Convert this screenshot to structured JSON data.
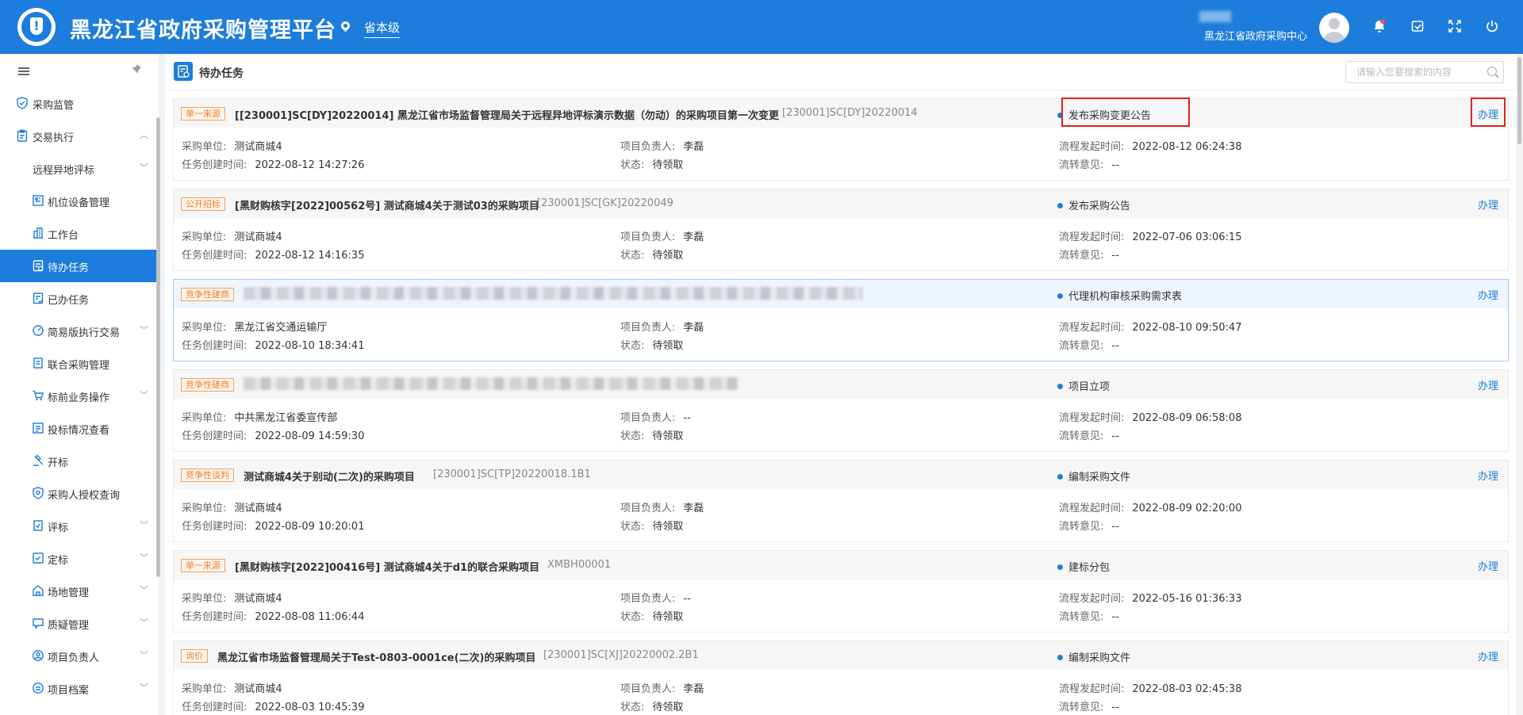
{
  "header": {
    "title": "黑龙江省政府采购管理平台",
    "level": "省本级",
    "org": "黑龙江省政府采购中心"
  },
  "sidebar": {
    "items": [
      {
        "label": "采购监管",
        "icon": "shield-icon"
      },
      {
        "label": "交易执行",
        "icon": "clipboard-icon"
      },
      {
        "label": "远程异地评标",
        "icon": ""
      },
      {
        "label": "机位设备管理",
        "icon": "device-icon"
      },
      {
        "label": "工作台",
        "icon": "building-icon"
      },
      {
        "label": "待办任务",
        "icon": "todo-icon"
      },
      {
        "label": "已办任务",
        "icon": "done-icon"
      },
      {
        "label": "简易版执行交易",
        "icon": "gauge-icon"
      },
      {
        "label": "联合采购管理",
        "icon": "document-icon"
      },
      {
        "label": "标前业务操作",
        "icon": "cart-icon"
      },
      {
        "label": "投标情况查看",
        "icon": "view-icon"
      },
      {
        "label": "开标",
        "icon": "hammer-icon"
      },
      {
        "label": "采购人授权查询",
        "icon": "auth-icon"
      },
      {
        "label": "评标",
        "icon": "evaluate-icon"
      },
      {
        "label": "定标",
        "icon": "award-icon"
      },
      {
        "label": "场地管理",
        "icon": "venue-icon"
      },
      {
        "label": "质疑管理",
        "icon": "question-icon"
      },
      {
        "label": "项目负责人",
        "icon": "person-icon"
      },
      {
        "label": "项目档案",
        "icon": "archive-icon"
      }
    ]
  },
  "main": {
    "title": "待办任务",
    "search_placeholder": "请输入您要搜索的内容",
    "labels": {
      "unit": "采购单位:",
      "manager": "项目负责人:",
      "flow_time": "流程发起时间:",
      "created": "任务创建时间:",
      "state": "状态:",
      "opinion": "流转意见:",
      "handle": "办理"
    },
    "tasks": [
      {
        "tag": "单一来源",
        "title": "[[230001]SC[DY]20220014] 黑龙江省市场监督管理局关于远程异地评标演示数据（勿动）的采购项目第一次变更",
        "code": "[230001]SC[DY]20220014",
        "status": "发布采购变更公告",
        "unit": "测试商城4",
        "manager": "李磊",
        "flow_time": "2022-08-12 06:24:38",
        "created": "2022-08-12 14:27:26",
        "state": "待领取",
        "opinion": "--"
      },
      {
        "tag": "公开招标",
        "title": "[黑财购核字[2022]00562号] 测试商城4关于测试03的采购项目",
        "code": "[230001]SC[GK]20220049",
        "status": "发布采购公告",
        "unit": "测试商城4",
        "manager": "李磊",
        "flow_time": "2022-07-06 03:06:15",
        "created": "2022-08-12 14:16:35",
        "state": "待领取",
        "opinion": "--"
      },
      {
        "tag": "竞争性磋商",
        "title": "",
        "code": "",
        "status": "代理机构审核采购需求表",
        "unit": "黑龙江省交通运输厅",
        "manager": "李磊",
        "flow_time": "2022-08-10 09:50:47",
        "created": "2022-08-10 18:34:41",
        "state": "待领取",
        "opinion": "--"
      },
      {
        "tag": "竞争性磋商",
        "title": "",
        "code": "",
        "status": "项目立项",
        "unit": "中共黑龙江省委宣传部",
        "manager": "--",
        "flow_time": "2022-08-09 06:58:08",
        "created": "2022-08-09 14:59:30",
        "state": "待领取",
        "opinion": "--"
      },
      {
        "tag": "竞争性谈判",
        "title": "测试商城4关于别动(二次)的采购项目",
        "code": "[230001]SC[TP]20220018.1B1",
        "status": "编制采购文件",
        "unit": "测试商城4",
        "manager": "李磊",
        "flow_time": "2022-08-09 02:20:00",
        "created": "2022-08-09 10:20:01",
        "state": "待领取",
        "opinion": "--"
      },
      {
        "tag": "单一来源",
        "title": "[黑财购核字[2022]00416号] 测试商城4关于d1的联合采购项目",
        "code": "XMBH00001",
        "status": "建标分包",
        "unit": "测试商城4",
        "manager": "--",
        "flow_time": "2022-05-16 01:36:33",
        "created": "2022-08-08 11:06:44",
        "state": "待领取",
        "opinion": "--"
      },
      {
        "tag": "询价",
        "title": "黑龙江省市场监督管理局关于Test-0803-0001ce(二次)的采购项目",
        "code": "[230001]SC[XJ]20220002.2B1",
        "status": "编制采购文件",
        "unit": "测试商城4",
        "manager": "李磊",
        "flow_time": "2022-08-03 02:45:38",
        "created": "2022-08-03 10:45:39",
        "state": "待领取",
        "opinion": "--"
      }
    ]
  }
}
